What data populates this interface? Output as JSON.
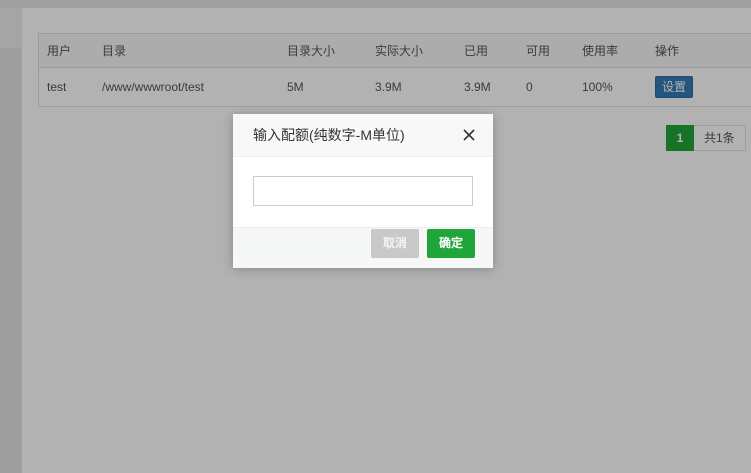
{
  "table": {
    "headers": [
      "用户",
      "目录",
      "目录大小",
      "实际大小",
      "已用",
      "可用",
      "使用率",
      "操作"
    ],
    "rows": [
      {
        "user": "test",
        "directory": "/www/wwwroot/test",
        "dir_size": "5M",
        "actual_size": "3.9M",
        "used": "3.9M",
        "available": "0",
        "usage_rate": "100%",
        "action_label": "设置"
      }
    ]
  },
  "pager": {
    "current_page": "1",
    "total_text": "共1条"
  },
  "modal": {
    "title": "输入配额(纯数字-M单位)",
    "input_value": "",
    "input_placeholder": "",
    "cancel_label": "取消",
    "confirm_label": "确定",
    "close_icon": "close-icon"
  },
  "colors": {
    "accent_green": "#20a53a",
    "button_blue": "#337ab7",
    "overlay": "rgba(0,0,0,0.3)"
  }
}
